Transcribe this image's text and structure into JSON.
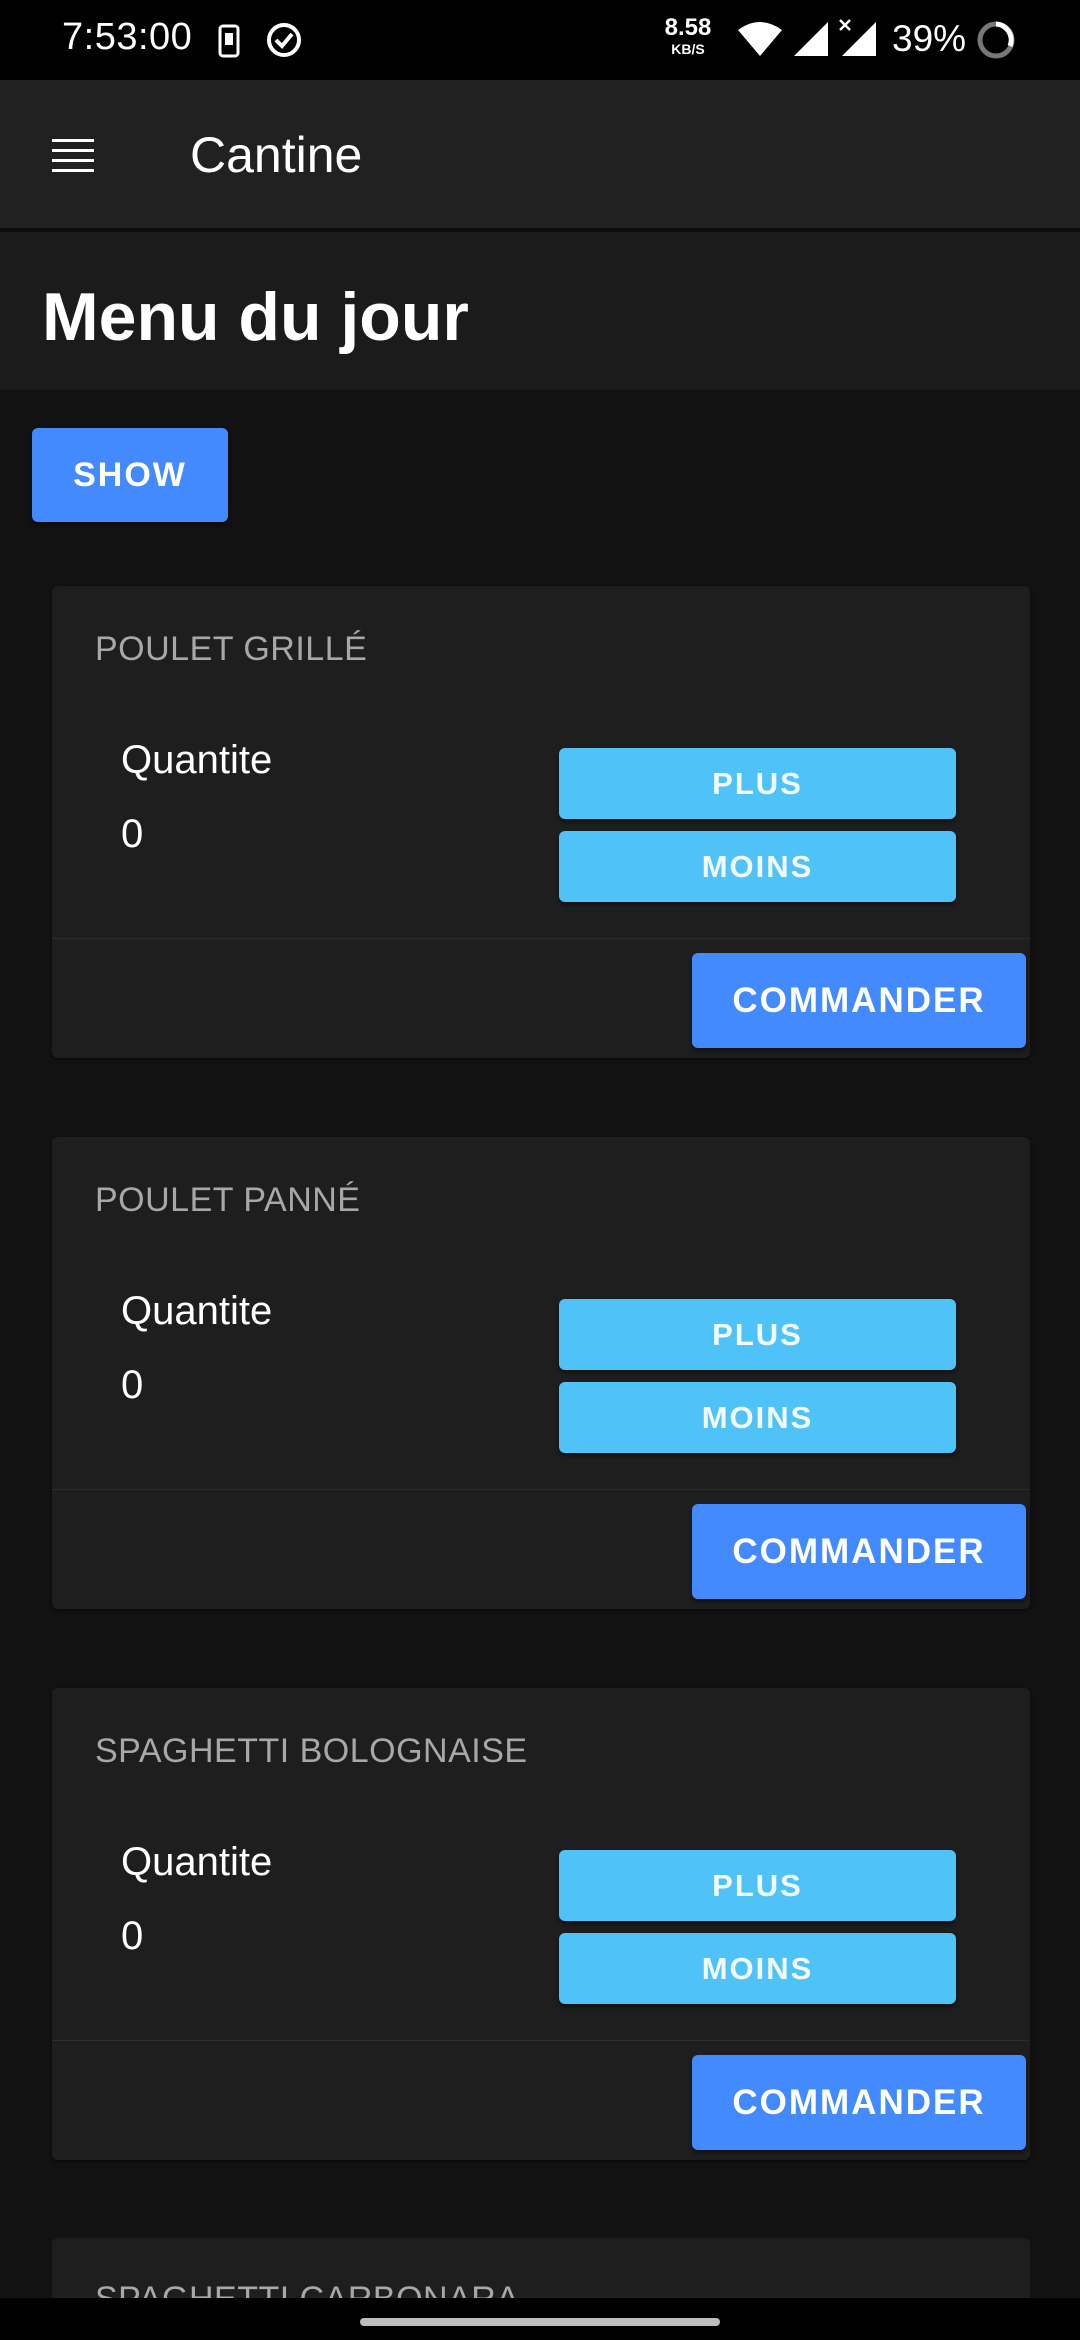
{
  "status_bar": {
    "time": "7:53:00",
    "net_speed_value": "8.58",
    "net_speed_unit": "KB/S",
    "battery": "39%"
  },
  "app_bar": {
    "title": "Cantine"
  },
  "page": {
    "title": "Menu du jour",
    "show_label": "SHOW"
  },
  "cards": [
    {
      "name": "POULET GRILLÉ",
      "qty_label": "Quantite",
      "qty": "0",
      "plus": "PLUS",
      "moins": "MOINS",
      "commander": "COMMANDER"
    },
    {
      "name": "POULET PANNÉ",
      "qty_label": "Quantite",
      "qty": "0",
      "plus": "PLUS",
      "moins": "MOINS",
      "commander": "COMMANDER"
    },
    {
      "name": "SPAGHETTI BOLOGNAISE",
      "qty_label": "Quantite",
      "qty": "0",
      "plus": "PLUS",
      "moins": "MOINS",
      "commander": "COMMANDER"
    },
    {
      "name": "SPAGHETTI CARBONARA"
    }
  ],
  "colors": {
    "primary": "#448aff",
    "light_blue": "#4fc3f7",
    "background": "#121212",
    "card": "#1e1e1e"
  },
  "icons": {
    "menu": "hamburger-menu-icon",
    "sim": "sim-card-icon",
    "data_saver": "data-saver-icon",
    "wifi": "wifi-icon",
    "signal": "cell-signal-icon",
    "battery": "battery-circle-icon"
  }
}
